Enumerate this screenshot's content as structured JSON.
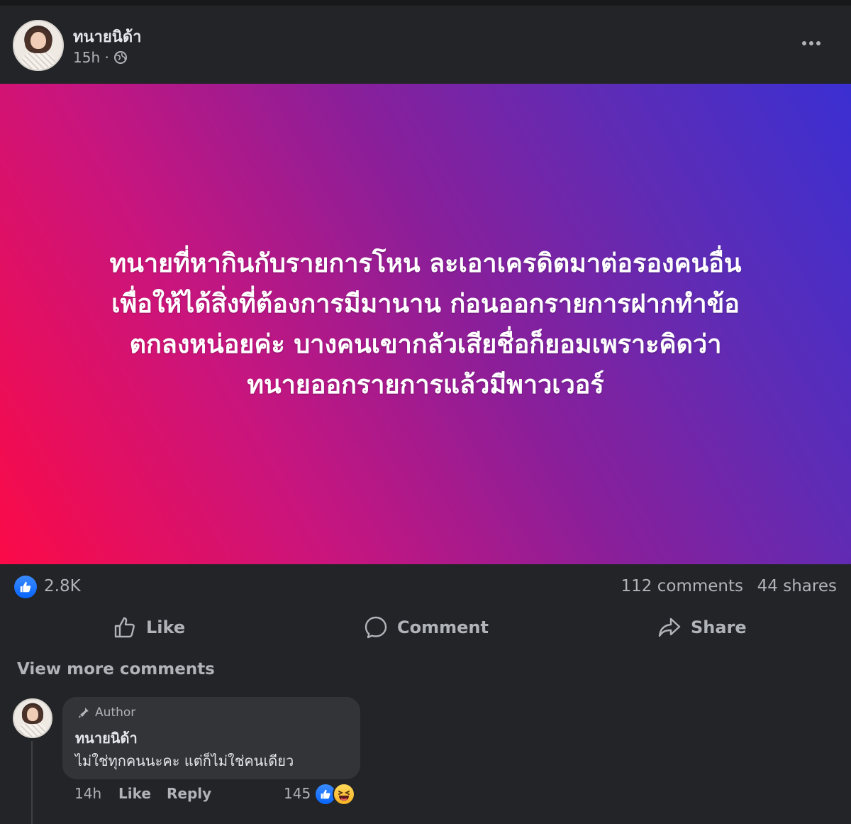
{
  "post": {
    "author": "ทนายนิด้า",
    "time": "15h ·",
    "privacy_icon": "globe-icon",
    "more_icon": "more-options-icon",
    "banner": {
      "text": "ทนายที่หากินกับรายการโหน ละเอาเครดิตมาต่อรองคนอื่น เพื่อให้ได้สิ่งที่ต้องการมีมานาน ก่อนออกรายการฝากทำข้อตกลงหน่อยค่ะ บางคนเขากลัวเสียชื่อก็ยอมเพราะคิดว่า ทนายออกรายการแล้วมีพาวเวอร์",
      "lines": [
        "ทนายที่หากินกับรายการโหน ละเอาเครดิตมาต่อรองคนอื่น",
        "เพื่อให้ได้สิ่งที่ต้องการมีมานาน ก่อนออกรายการฝากทำข้อ",
        "ตกลงหน่อยค่ะ บางคนเขากลัวเสียชื่อก็ยอมเพราะคิดว่า",
        "ทนายออกรายการแล้วมีพาวเวอร์"
      ],
      "gradient_colors": [
        "#fb0a47",
        "#c8157e",
        "#8a1f9a",
        "#5d2cb6",
        "#3b2fd2"
      ]
    },
    "stats": {
      "reactions": "2.8K",
      "comments": "112 comments",
      "shares": "44 shares"
    },
    "actions": {
      "like": "Like",
      "comment": "Comment",
      "share": "Share"
    },
    "view_more": "View more comments"
  },
  "comment": {
    "badge": "Author",
    "name": "ทนายนิด้า",
    "text": "ไม่ใช่ทุกคนนะคะ แต่ก็ไม่ใช่คนเดียว",
    "time": "14h",
    "like": "Like",
    "reply": "Reply",
    "reaction_count": "145",
    "reaction_icons": [
      "like-reaction-icon",
      "haha-reaction-icon"
    ]
  },
  "colors": {
    "background": "#232427",
    "bubble": "#333437",
    "accent_blue": "#0866ff",
    "text_primary": "#e4e6eb",
    "text_secondary": "#b0b3b8"
  }
}
